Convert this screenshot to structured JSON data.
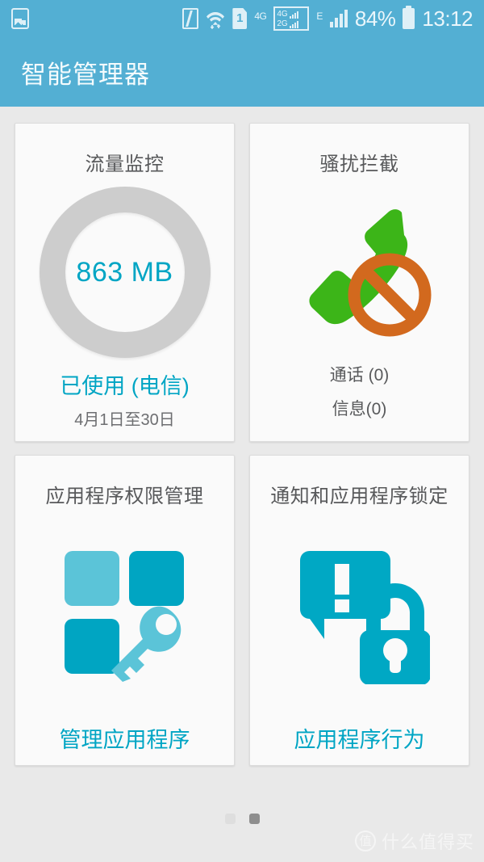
{
  "status_bar": {
    "left_icon": "photo-icon",
    "icons": [
      "nfc-icon",
      "wifi-icon",
      "sim-1-icon"
    ],
    "network_label": "4G",
    "dual_sim": {
      "row1": "4G",
      "row2": "2G"
    },
    "edge_label": "E",
    "signal_icon": "signal-bars-icon",
    "battery_percent": "84%",
    "battery_icon": "battery-icon",
    "clock": "13:12"
  },
  "header": {
    "title": "智能管理器"
  },
  "colors": {
    "header_blue": "#53afd3",
    "accent_cyan": "#00a5c4",
    "ring_grey": "#cdcdcd",
    "phone_green": "#3cb518",
    "block_orange": "#d2691e",
    "icon_teal": "#00a5c2",
    "icon_teal_light": "#5bc4d8",
    "card_bg": "#fafafa",
    "page_bg": "#e9e9e9"
  },
  "cards": [
    {
      "id": "data-usage",
      "title": "流量监控",
      "donut_value": "863 MB",
      "footer_primary": "已使用 (电信)",
      "footer_secondary": "4月1日至30日"
    },
    {
      "id": "call-block",
      "title": "骚扰拦截",
      "icon": "blocked-call-icon",
      "stats": [
        "通话 (0)",
        "信息(0)"
      ]
    },
    {
      "id": "app-permissions",
      "title": "应用程序权限管理",
      "icon": "apps-key-icon",
      "link_label": "管理应用程序"
    },
    {
      "id": "notification-app-lock",
      "title": "通知和应用程序锁定",
      "icon": "notification-lock-icon",
      "link_label": "应用程序行为"
    }
  ],
  "pagination": {
    "total": 2,
    "active_index": 1
  },
  "watermark": {
    "logo_char": "值",
    "text": "什么值得买"
  }
}
